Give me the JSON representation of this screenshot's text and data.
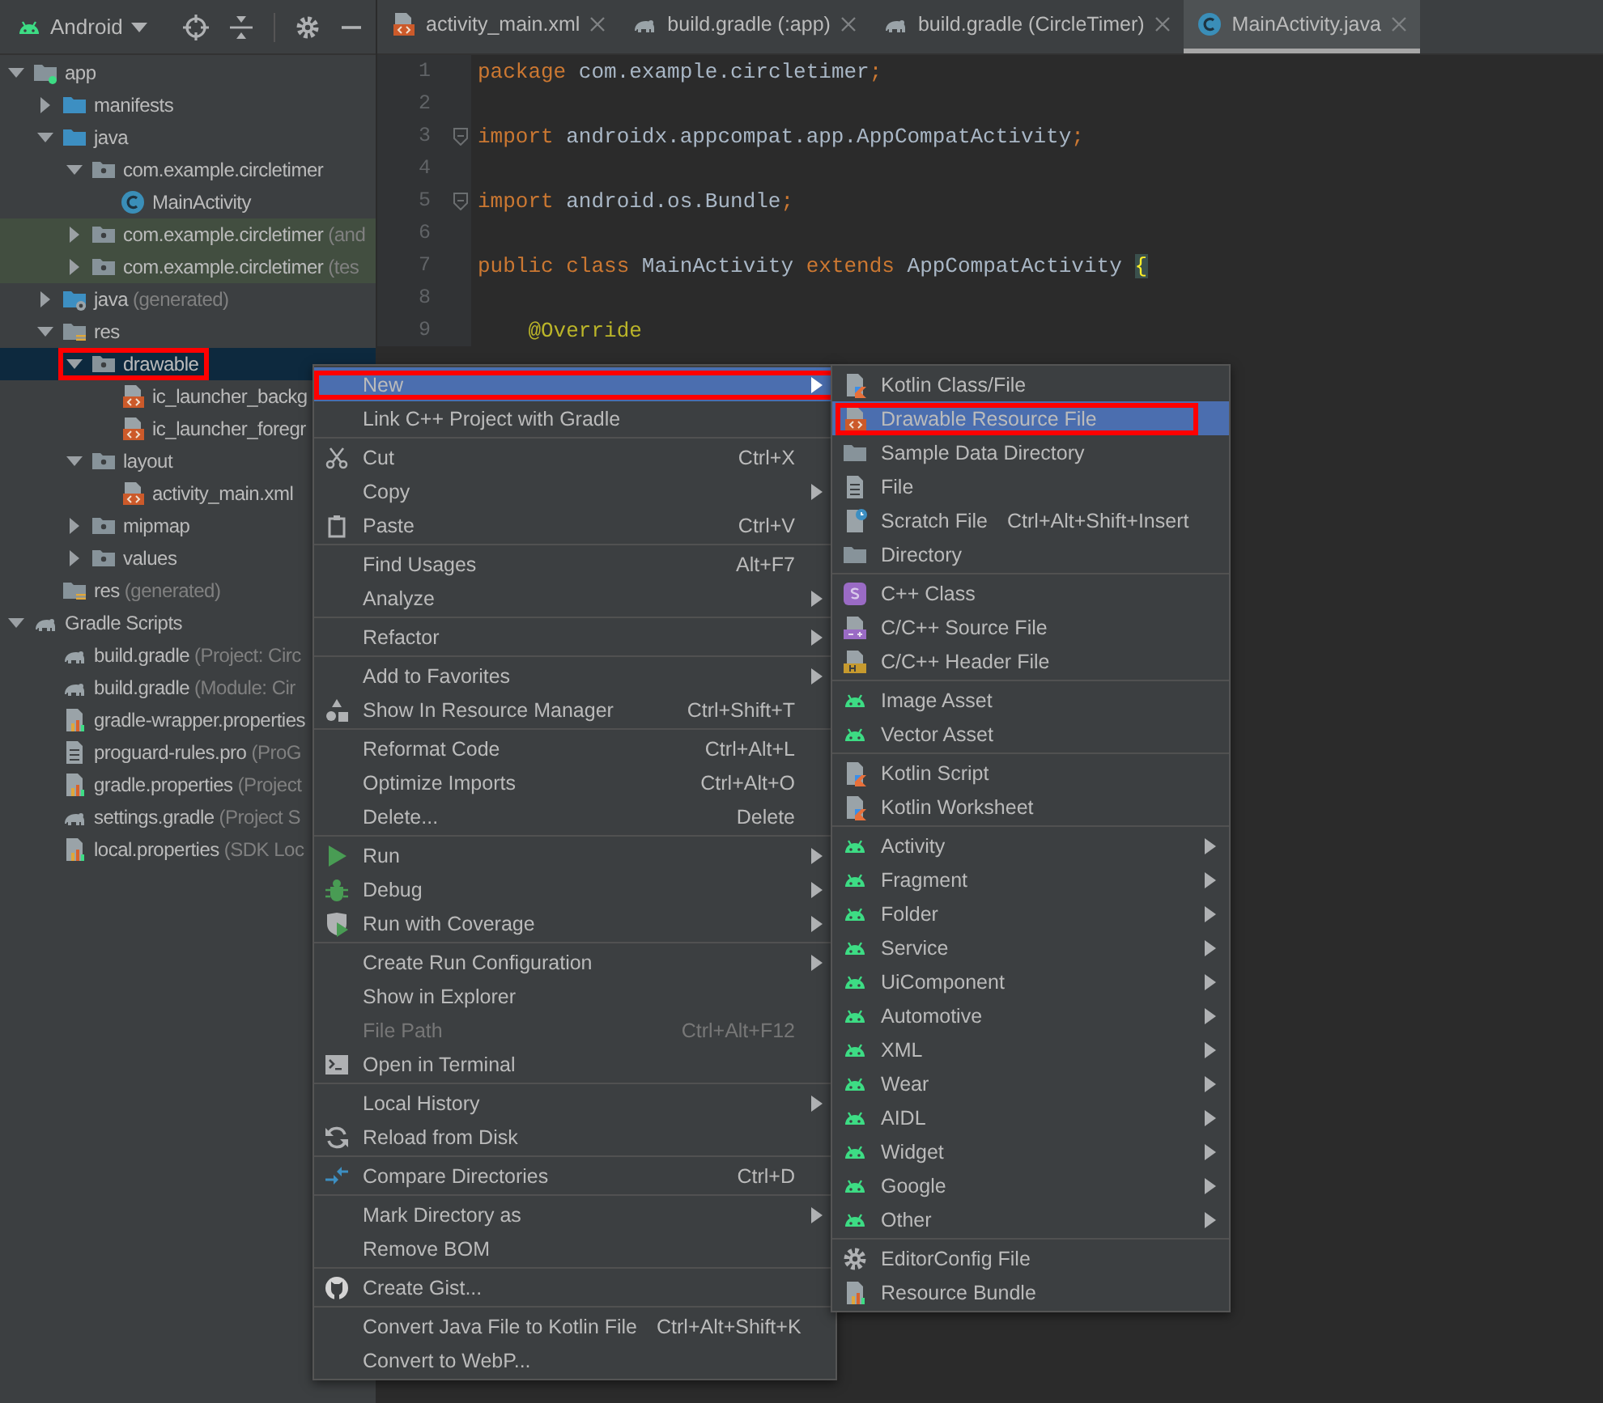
{
  "project_panel": {
    "view": "Android",
    "tree": [
      {
        "label": "app",
        "kind": "module",
        "expanded": true,
        "selected": false,
        "shaded": false,
        "marked": false,
        "children": [
          {
            "label": "manifests",
            "kind": "srcfolder",
            "expanded": false,
            "selected": false,
            "shaded": false,
            "marked": false
          },
          {
            "label": "java",
            "kind": "srcfolder",
            "expanded": true,
            "selected": false,
            "shaded": false,
            "marked": false,
            "children": [
              {
                "label": "com.example.circletimer",
                "kind": "package",
                "expanded": true,
                "selected": false,
                "shaded": false,
                "marked": false,
                "children": [
                  {
                    "label": "MainActivity",
                    "kind": "class",
                    "selected": false,
                    "shaded": false,
                    "marked": false
                  }
                ]
              },
              {
                "label": "com.example.circletimer",
                "hint": "(and",
                "kind": "package",
                "expanded": false,
                "selected": false,
                "shaded": true,
                "marked": false
              },
              {
                "label": "com.example.circletimer",
                "hint": "(tes",
                "kind": "package",
                "expanded": false,
                "selected": false,
                "shaded": true,
                "marked": false
              }
            ]
          },
          {
            "label": "java",
            "hint": "(generated)",
            "kind": "javagen",
            "expanded": false,
            "selected": false,
            "shaded": false,
            "marked": false
          },
          {
            "label": "res",
            "kind": "res",
            "expanded": true,
            "selected": false,
            "shaded": false,
            "marked": false,
            "children": [
              {
                "label": "drawable",
                "kind": "package",
                "expanded": true,
                "selected": true,
                "shaded": false,
                "marked": true,
                "children": [
                  {
                    "label": "ic_launcher_backg",
                    "kind": "xml",
                    "selected": false,
                    "shaded": false,
                    "marked": false
                  },
                  {
                    "label": "ic_launcher_foregr",
                    "kind": "xml",
                    "selected": false,
                    "shaded": false,
                    "marked": false
                  }
                ]
              },
              {
                "label": "layout",
                "kind": "package",
                "expanded": true,
                "selected": false,
                "shaded": false,
                "marked": false,
                "children": [
                  {
                    "label": "activity_main.xml",
                    "kind": "xml",
                    "selected": false,
                    "shaded": false,
                    "marked": false
                  }
                ]
              },
              {
                "label": "mipmap",
                "kind": "package",
                "expanded": false,
                "selected": false,
                "shaded": false,
                "marked": false
              },
              {
                "label": "values",
                "kind": "package",
                "expanded": false,
                "selected": false,
                "shaded": false,
                "marked": false
              }
            ]
          },
          {
            "label": "res",
            "hint": "(generated)",
            "kind": "res",
            "selected": false,
            "shaded": false,
            "marked": false
          }
        ]
      },
      {
        "label": "Gradle Scripts",
        "kind": "gradle",
        "expanded": true,
        "selected": false,
        "shaded": false,
        "marked": false,
        "children": [
          {
            "label": "build.gradle",
            "hint": "(Project: Circ",
            "kind": "gradle",
            "selected": false,
            "shaded": false,
            "marked": false
          },
          {
            "label": "build.gradle",
            "hint": "(Module: Cir",
            "kind": "gradle",
            "selected": false,
            "shaded": false,
            "marked": false
          },
          {
            "label": "gradle-wrapper.properties",
            "kind": "props",
            "selected": false,
            "shaded": false,
            "marked": false
          },
          {
            "label": "proguard-rules.pro",
            "hint": "(ProG",
            "kind": "text",
            "selected": false,
            "shaded": false,
            "marked": false
          },
          {
            "label": "gradle.properties",
            "hint": "(Project",
            "kind": "props",
            "selected": false,
            "shaded": false,
            "marked": false
          },
          {
            "label": "settings.gradle",
            "hint": "(Project S",
            "kind": "gradle",
            "selected": false,
            "shaded": false,
            "marked": false
          },
          {
            "label": "local.properties",
            "hint": "(SDK Loc",
            "kind": "props",
            "selected": false,
            "shaded": false,
            "marked": false
          }
        ]
      }
    ]
  },
  "editor": {
    "tabs": [
      {
        "label": "activity_main.xml",
        "kind": "xml",
        "selected": false
      },
      {
        "label": "build.gradle (:app)",
        "kind": "gradle",
        "selected": false
      },
      {
        "label": "build.gradle (CircleTimer)",
        "kind": "gradle",
        "selected": false
      },
      {
        "label": "MainActivity.java",
        "kind": "class",
        "selected": true
      }
    ],
    "lines": [
      {
        "number": "1",
        "fold": false,
        "tokens": [
          {
            "kind": "kw",
            "text": "package "
          },
          {
            "kind": "plain",
            "text": "com.example.circletimer"
          },
          {
            "kind": "kw",
            "text": ";"
          }
        ]
      },
      {
        "number": "2",
        "fold": false
      },
      {
        "number": "3",
        "fold": true,
        "tokens": [
          {
            "kind": "kw",
            "text": "import "
          },
          {
            "kind": "plain",
            "text": "androidx.appcompat.app.AppCompatActivity"
          },
          {
            "kind": "kw",
            "text": ";"
          }
        ]
      },
      {
        "number": "4",
        "fold": false
      },
      {
        "number": "5",
        "fold": true,
        "tokens": [
          {
            "kind": "kw",
            "text": "import "
          },
          {
            "kind": "plain",
            "text": "android.os.Bundle"
          },
          {
            "kind": "kw",
            "text": ";"
          }
        ]
      },
      {
        "number": "6",
        "fold": false
      },
      {
        "number": "7",
        "fold": false,
        "tokens": [
          {
            "kind": "kw",
            "text": "public class "
          },
          {
            "kind": "plain",
            "text": "MainActivity "
          },
          {
            "kind": "kw",
            "text": "extends "
          },
          {
            "kind": "plain",
            "text": "AppCompatActivity "
          },
          {
            "kind": "brace",
            "text": "{"
          }
        ]
      },
      {
        "number": "8",
        "fold": false
      },
      {
        "number": "9",
        "fold": false,
        "tokens": [
          {
            "kind": "ann",
            "text": "    @Override"
          }
        ]
      }
    ]
  },
  "context_menu": [
    [
      {
        "label": "New",
        "kind": "plain",
        "submenu": true,
        "selected": true,
        "disabled": false,
        "marked": true
      },
      {
        "label": "Link C++ Project with Gradle",
        "kind": "plain",
        "submenu": false,
        "selected": false,
        "disabled": false,
        "marked": false
      }
    ],
    [
      {
        "label": "Cut",
        "kind": "cut",
        "shortcut": "Ctrl+X",
        "submenu": false,
        "selected": false,
        "disabled": false,
        "marked": false
      },
      {
        "label": "Copy",
        "kind": "plain",
        "submenu": true,
        "selected": false,
        "disabled": false,
        "marked": false
      },
      {
        "label": "Paste",
        "kind": "paste",
        "shortcut": "Ctrl+V",
        "submenu": false,
        "selected": false,
        "disabled": false,
        "marked": false
      }
    ],
    [
      {
        "label": "Find Usages",
        "kind": "plain",
        "shortcut": "Alt+F7",
        "submenu": false,
        "selected": false,
        "disabled": false,
        "marked": false
      },
      {
        "label": "Analyze",
        "kind": "plain",
        "submenu": true,
        "selected": false,
        "disabled": false,
        "marked": false
      }
    ],
    [
      {
        "label": "Refactor",
        "kind": "plain",
        "submenu": true,
        "selected": false,
        "disabled": false,
        "marked": false
      }
    ],
    [
      {
        "label": "Add to Favorites",
        "kind": "plain",
        "submenu": true,
        "selected": false,
        "disabled": false,
        "marked": false
      },
      {
        "label": "Show In Resource Manager",
        "kind": "shapes",
        "shortcut": "Ctrl+Shift+T",
        "submenu": false,
        "selected": false,
        "disabled": false,
        "marked": false
      }
    ],
    [
      {
        "label": "Reformat Code",
        "kind": "plain",
        "shortcut": "Ctrl+Alt+L",
        "submenu": false,
        "selected": false,
        "disabled": false,
        "marked": false
      },
      {
        "label": "Optimize Imports",
        "kind": "plain",
        "shortcut": "Ctrl+Alt+O",
        "submenu": false,
        "selected": false,
        "disabled": false,
        "marked": false
      },
      {
        "label": "Delete...",
        "kind": "plain",
        "shortcut": "Delete",
        "submenu": false,
        "selected": false,
        "disabled": false,
        "marked": false
      }
    ],
    [
      {
        "label": "Run",
        "kind": "run",
        "submenu": true,
        "selected": false,
        "disabled": false,
        "marked": false
      },
      {
        "label": "Debug",
        "kind": "bug",
        "submenu": true,
        "selected": false,
        "disabled": false,
        "marked": false
      },
      {
        "label": "Run with Coverage",
        "kind": "coverage",
        "submenu": true,
        "selected": false,
        "disabled": false,
        "marked": false
      }
    ],
    [
      {
        "label": "Create Run Configuration",
        "kind": "plain",
        "submenu": true,
        "selected": false,
        "disabled": false,
        "marked": false
      },
      {
        "label": "Show in Explorer",
        "kind": "plain",
        "submenu": false,
        "selected": false,
        "disabled": false,
        "marked": false
      },
      {
        "label": "File Path",
        "kind": "plain",
        "shortcut": "Ctrl+Alt+F12",
        "submenu": false,
        "selected": false,
        "disabled": true,
        "marked": false
      },
      {
        "label": "Open in Terminal",
        "kind": "terminal",
        "submenu": false,
        "selected": false,
        "disabled": false,
        "marked": false
      }
    ],
    [
      {
        "label": "Local History",
        "kind": "plain",
        "submenu": true,
        "selected": false,
        "disabled": false,
        "marked": false
      },
      {
        "label": "Reload from Disk",
        "kind": "reload",
        "submenu": false,
        "selected": false,
        "disabled": false,
        "marked": false
      }
    ],
    [
      {
        "label": "Compare Directories",
        "kind": "compare",
        "shortcut": "Ctrl+D",
        "submenu": false,
        "selected": false,
        "disabled": false,
        "marked": false
      }
    ],
    [
      {
        "label": "Mark Directory as",
        "kind": "plain",
        "submenu": true,
        "selected": false,
        "disabled": false,
        "marked": false
      },
      {
        "label": "Remove BOM",
        "kind": "plain",
        "submenu": false,
        "selected": false,
        "disabled": false,
        "marked": false
      }
    ],
    [
      {
        "label": "Create Gist...",
        "kind": "cat",
        "submenu": false,
        "selected": false,
        "disabled": false,
        "marked": false
      }
    ],
    [
      {
        "label": "Convert Java File to Kotlin File",
        "kind": "plain",
        "shortcut": "Ctrl+Alt+Shift+K",
        "submenu": false,
        "selected": false,
        "disabled": false,
        "marked": false
      },
      {
        "label": "Convert to WebP...",
        "kind": "plain",
        "submenu": false,
        "selected": false,
        "disabled": false,
        "marked": false
      }
    ]
  ],
  "new_submenu": [
    [
      {
        "label": "Kotlin Class/File",
        "kind": "kotlin",
        "submenu": false,
        "selected": false,
        "disabled": false,
        "marked": false
      },
      {
        "label": "Drawable Resource File",
        "kind": "xml",
        "submenu": false,
        "selected": true,
        "disabled": false,
        "marked": true
      },
      {
        "label": "Sample Data Directory",
        "kind": "folder",
        "submenu": false,
        "selected": false,
        "disabled": false,
        "marked": false
      },
      {
        "label": "File",
        "kind": "text",
        "submenu": false,
        "selected": false,
        "disabled": false,
        "marked": false
      },
      {
        "label": "Scratch File",
        "kind": "scratch",
        "shortcut": "Ctrl+Alt+Shift+Insert",
        "submenu": false,
        "selected": false,
        "disabled": false,
        "marked": false
      },
      {
        "label": "Directory",
        "kind": "folder",
        "submenu": false,
        "selected": false,
        "disabled": false,
        "marked": false
      }
    ],
    [
      {
        "label": "C++ Class",
        "kind": "cppclass",
        "submenu": false,
        "selected": false,
        "disabled": false,
        "marked": false
      },
      {
        "label": "C/C++ Source File",
        "kind": "cpp",
        "submenu": false,
        "selected": false,
        "disabled": false,
        "marked": false
      },
      {
        "label": "C/C++ Header File",
        "kind": "header",
        "submenu": false,
        "selected": false,
        "disabled": false,
        "marked": false
      }
    ],
    [
      {
        "label": "Image Asset",
        "kind": "android",
        "submenu": false,
        "selected": false,
        "disabled": false,
        "marked": false
      },
      {
        "label": "Vector Asset",
        "kind": "android",
        "submenu": false,
        "selected": false,
        "disabled": false,
        "marked": false
      }
    ],
    [
      {
        "label": "Kotlin Script",
        "kind": "kotlin",
        "submenu": false,
        "selected": false,
        "disabled": false,
        "marked": false
      },
      {
        "label": "Kotlin Worksheet",
        "kind": "kotlin",
        "submenu": false,
        "selected": false,
        "disabled": false,
        "marked": false
      }
    ],
    [
      {
        "label": "Activity",
        "kind": "android",
        "submenu": true,
        "selected": false,
        "disabled": false,
        "marked": false
      },
      {
        "label": "Fragment",
        "kind": "android",
        "submenu": true,
        "selected": false,
        "disabled": false,
        "marked": false
      },
      {
        "label": "Folder",
        "kind": "android",
        "submenu": true,
        "selected": false,
        "disabled": false,
        "marked": false
      },
      {
        "label": "Service",
        "kind": "android",
        "submenu": true,
        "selected": false,
        "disabled": false,
        "marked": false
      },
      {
        "label": "UiComponent",
        "kind": "android",
        "submenu": true,
        "selected": false,
        "disabled": false,
        "marked": false
      },
      {
        "label": "Automotive",
        "kind": "android",
        "submenu": true,
        "selected": false,
        "disabled": false,
        "marked": false
      },
      {
        "label": "XML",
        "kind": "android",
        "submenu": true,
        "selected": false,
        "disabled": false,
        "marked": false
      },
      {
        "label": "Wear",
        "kind": "android",
        "submenu": true,
        "selected": false,
        "disabled": false,
        "marked": false
      },
      {
        "label": "AIDL",
        "kind": "android",
        "submenu": true,
        "selected": false,
        "disabled": false,
        "marked": false
      },
      {
        "label": "Widget",
        "kind": "android",
        "submenu": true,
        "selected": false,
        "disabled": false,
        "marked": false
      },
      {
        "label": "Google",
        "kind": "android",
        "submenu": true,
        "selected": false,
        "disabled": false,
        "marked": false
      },
      {
        "label": "Other",
        "kind": "android",
        "submenu": true,
        "selected": false,
        "disabled": false,
        "marked": false
      }
    ],
    [
      {
        "label": "EditorConfig File",
        "kind": "gear",
        "submenu": false,
        "selected": false,
        "disabled": false,
        "marked": false
      },
      {
        "label": "Resource Bundle",
        "kind": "props",
        "submenu": false,
        "selected": false,
        "disabled": false,
        "marked": false
      }
    ]
  ]
}
